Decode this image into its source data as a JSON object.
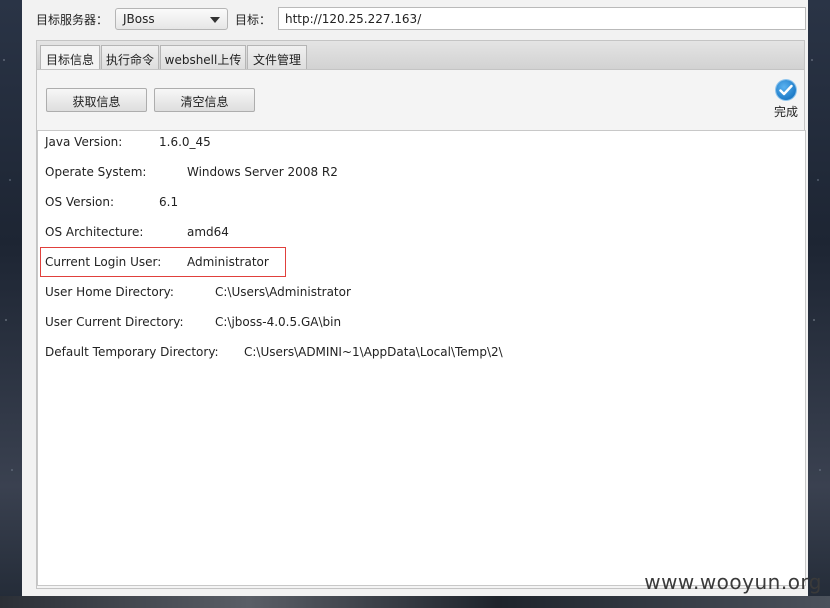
{
  "top": {
    "server_label": "目标服务器：",
    "server_value": "JBoss",
    "target_label": "目标：",
    "target_url": "http://120.25.227.163/"
  },
  "tabs": [
    {
      "label": "目标信息",
      "active": true
    },
    {
      "label": "执行命令",
      "active": false
    },
    {
      "label": "webshell上传",
      "active": false
    },
    {
      "label": "文件管理",
      "active": false
    }
  ],
  "toolbar": {
    "get_info_label": "获取信息",
    "clear_info_label": "清空信息",
    "status_text": "完成",
    "status_icon": "check-circle-icon"
  },
  "info_rows": [
    {
      "key": "Java Version:",
      "value": "1.6.0_45"
    },
    {
      "key": "Operate System:",
      "value": "Windows Server 2008 R2"
    },
    {
      "key": "OS Version:",
      "value": "6.1"
    },
    {
      "key": "OS Architecture:",
      "value": "amd64"
    },
    {
      "key": "Current Login User:",
      "value": "Administrator"
    },
    {
      "key": "User Home Directory:",
      "value": "C:\\Users\\Administrator"
    },
    {
      "key": "User Current Directory:",
      "value": "C:\\jboss-4.0.5.GA\\bin"
    },
    {
      "key": "Default Temporary Directory:",
      "value": "C:\\Users\\ADMINI~1\\AppData\\Local\\Temp\\2\\"
    }
  ],
  "watermark": "www.wooyun.org",
  "colors": {
    "highlight_border": "#e0403c",
    "status_icon": "#1e7cc8"
  }
}
